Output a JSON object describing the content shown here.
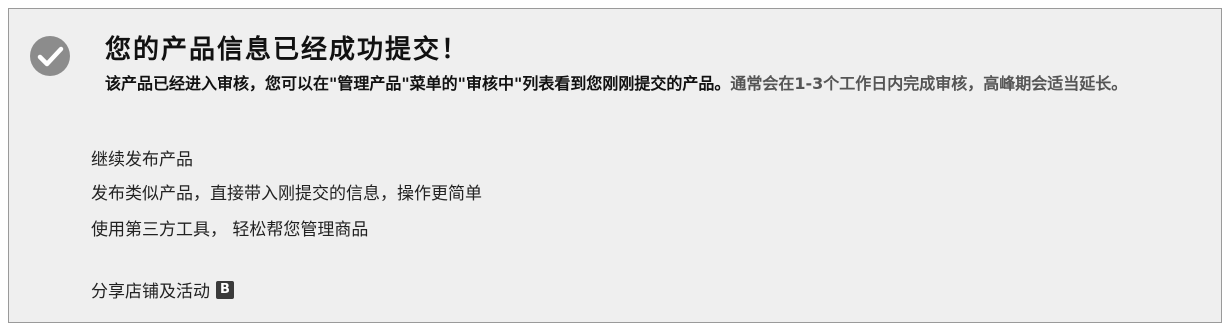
{
  "success": {
    "title": "您的产品信息已经成功提交！",
    "description_main": "该产品已经进入审核，您可以在\"管理产品\"菜单的\"审核中\"列表看到您刚刚提交的产品。",
    "description_note": "通常会在1-3个工作日内完成审核，高峰期会适当延长。"
  },
  "actions": {
    "continue_label": "继续发布产品",
    "similar_label": "发布类似产品，直接带入刚提交的信息，操作更简单",
    "tools_label": "使用第三方工具， 轻松帮您管理商品",
    "share_label": "分享店铺及活动",
    "share_badge": "B"
  },
  "icons": {
    "success": "check-circle-icon"
  },
  "colors": {
    "panel_background": "#efefef",
    "panel_border": "#9a9a9a",
    "check_circle": "#8c8c8c",
    "note_text": "#555555"
  }
}
